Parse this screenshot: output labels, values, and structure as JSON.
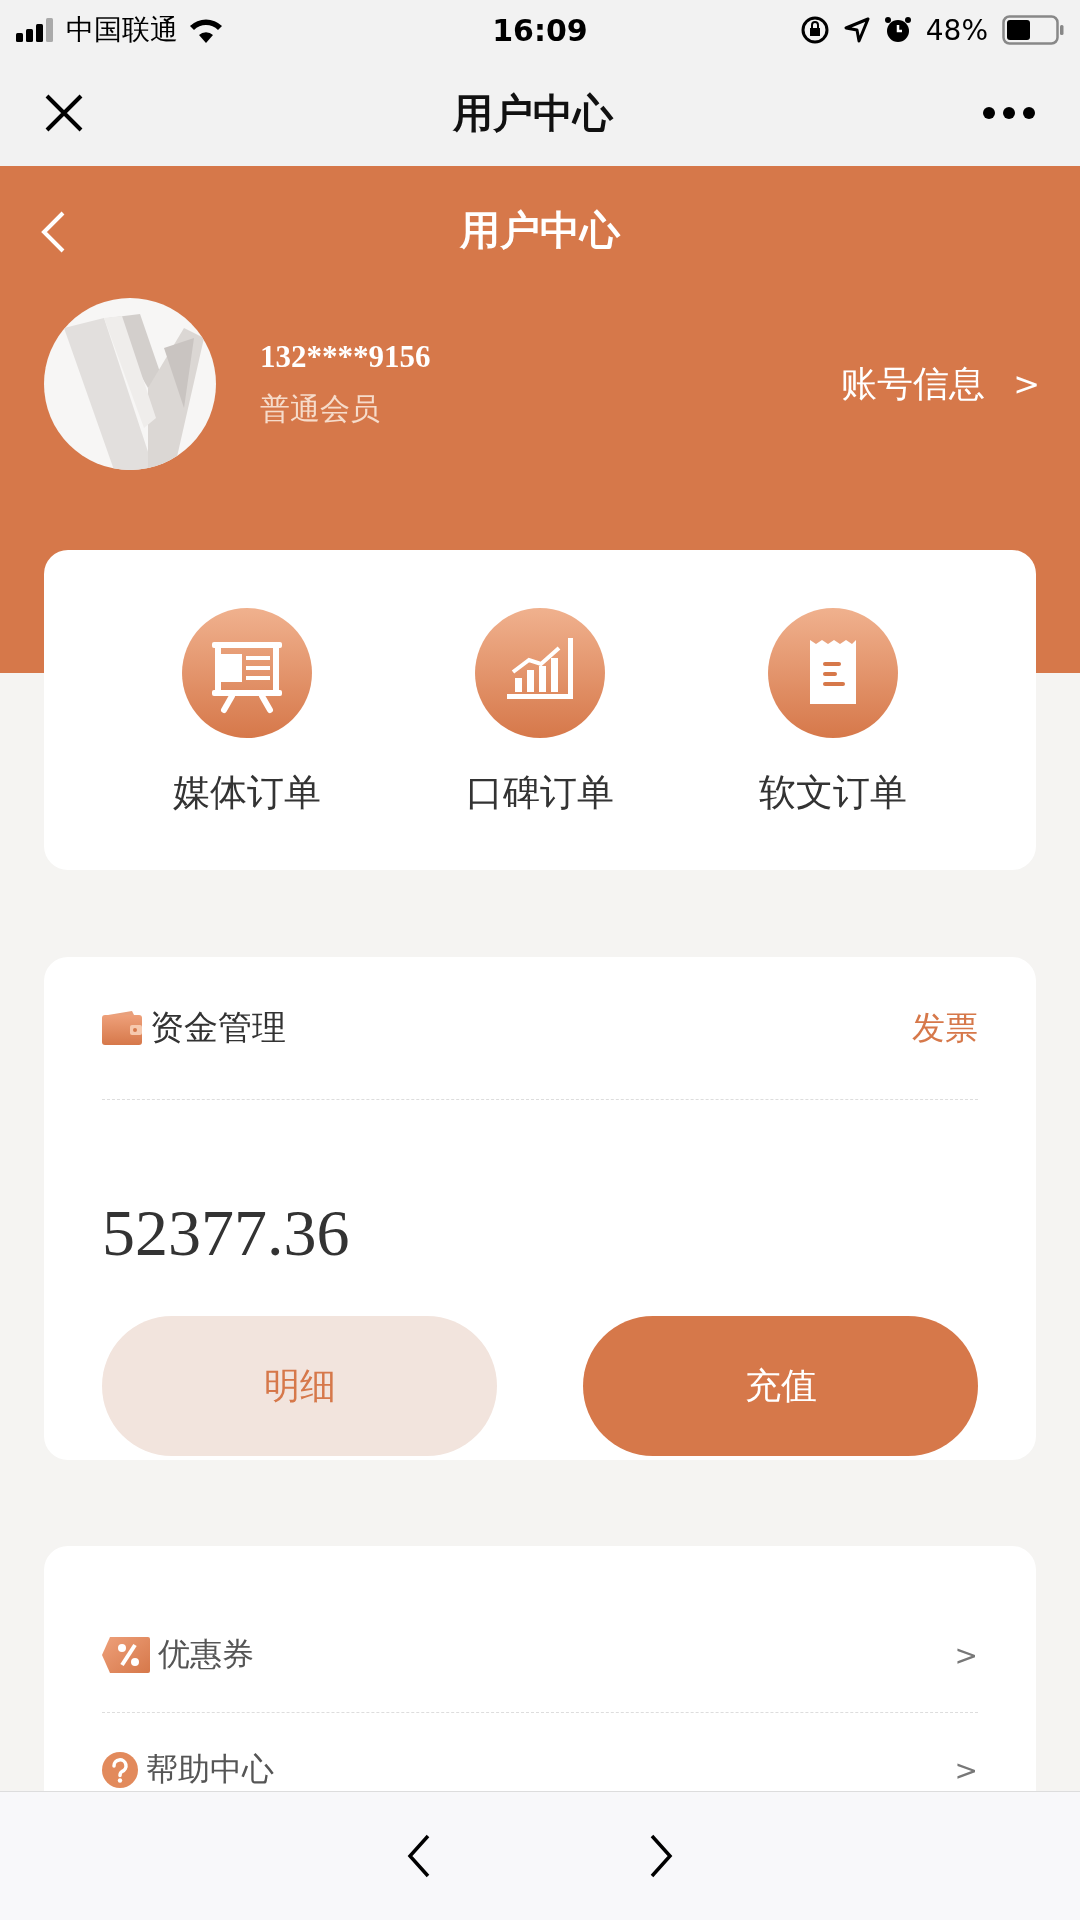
{
  "status_bar": {
    "carrier": "中国联通",
    "time": "16:09",
    "battery": "48%"
  },
  "nav_bar": {
    "title": "用户中心"
  },
  "header": {
    "title": "用户中心",
    "phone": "132****9156",
    "member_level": "普通会员",
    "account_link": "账号信息",
    "account_arrow": ">"
  },
  "orders": [
    {
      "kind": "media",
      "label": "媒体订单"
    },
    {
      "kind": "reputation",
      "label": "口碑订单"
    },
    {
      "kind": "article",
      "label": "软文订单"
    }
  ],
  "funds": {
    "title": "资金管理",
    "invoice": "发票",
    "balance": "52377.36",
    "buttons": [
      {
        "kind": "secondary",
        "label": "明细"
      },
      {
        "kind": "primary",
        "label": "充值"
      }
    ]
  },
  "menu": [
    {
      "kind": "coupon",
      "label": "优惠券",
      "arrow": ">"
    },
    {
      "kind": "help",
      "label": "帮助中心",
      "arrow": ">"
    }
  ]
}
